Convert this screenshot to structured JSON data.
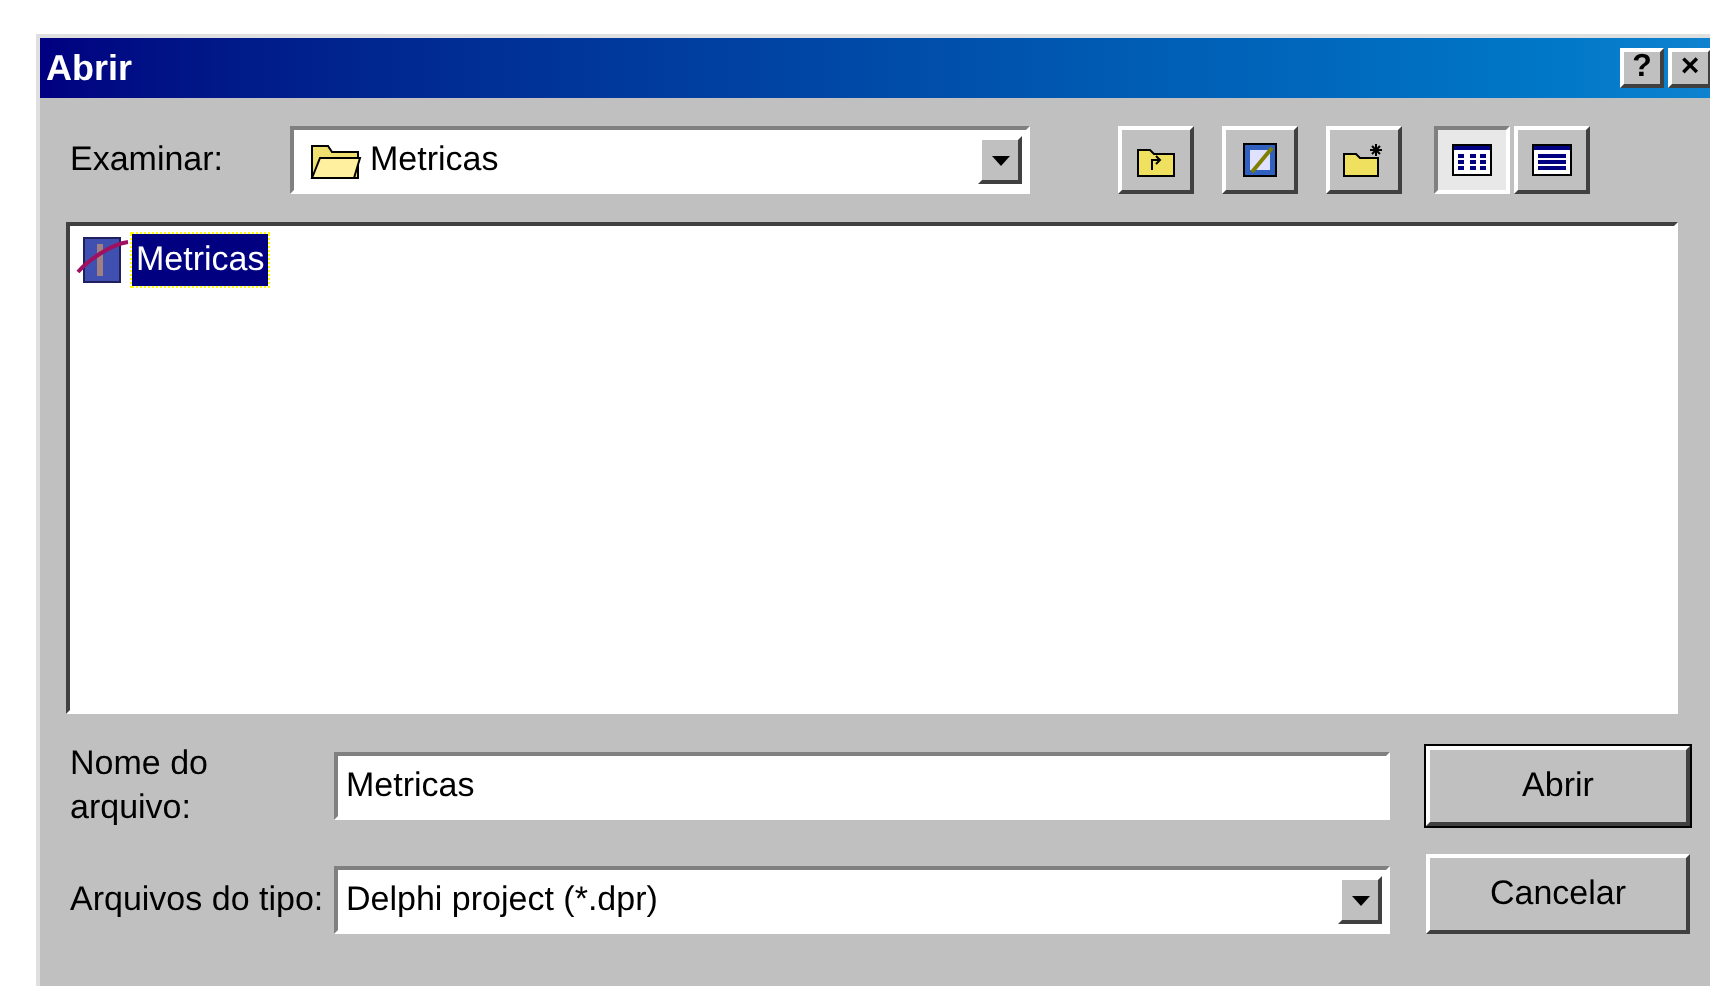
{
  "window": {
    "title": "Abrir",
    "controls": [
      "?",
      "×"
    ]
  },
  "look_in": {
    "label": "Examinar:",
    "value": "Metricas"
  },
  "toolbar": [
    {
      "kind": "up"
    },
    {
      "kind": "desktop"
    },
    {
      "kind": "new-folder"
    },
    {
      "kind": "list",
      "selected": true
    },
    {
      "kind": "details",
      "selected": false
    }
  ],
  "files": [
    {
      "name": "Metricas",
      "selected": true
    }
  ],
  "file_name": {
    "label": "Nome do arquivo:",
    "value": "Metricas"
  },
  "file_type": {
    "label": "Arquivos do tipo:",
    "value": "Delphi project (*.dpr)"
  },
  "buttons": [
    "Abrir",
    "Cancelar"
  ]
}
